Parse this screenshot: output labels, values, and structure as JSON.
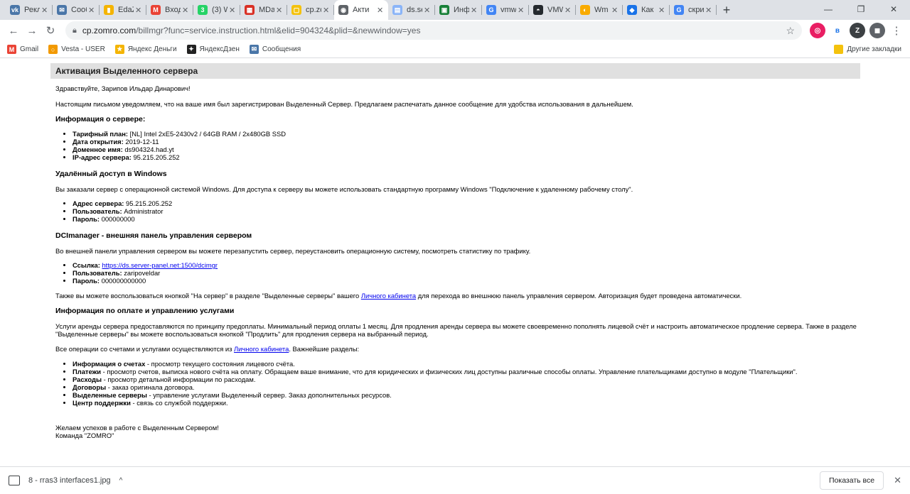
{
  "tabs": [
    {
      "title": "Рекл",
      "icon": "vk-icon",
      "color": "#4a76a8",
      "glyph": "vk"
    },
    {
      "title": "Сооб",
      "icon": "message-icon",
      "color": "#4a76a8",
      "glyph": "✉"
    },
    {
      "title": "EdaZ",
      "icon": "chart-icon",
      "color": "#f4b400",
      "glyph": "▮"
    },
    {
      "title": "Вход",
      "icon": "gmail-icon",
      "color": "#ea4335",
      "glyph": "M"
    },
    {
      "title": "(3) W",
      "icon": "whatsapp-icon",
      "color": "#25d366",
      "glyph": "3"
    },
    {
      "title": "MDa",
      "icon": "mdaemon-icon",
      "color": "#d93025",
      "glyph": "▦"
    },
    {
      "title": "cp.zo",
      "icon": "folder-icon",
      "color": "#f4c20d",
      "glyph": "▢"
    },
    {
      "title": "Акти",
      "icon": "globe-icon",
      "color": "#5f6368",
      "glyph": "◉",
      "active": true
    },
    {
      "title": "ds.se",
      "icon": "doc-icon",
      "color": "#8ab4f8",
      "glyph": "▤"
    },
    {
      "title": "Инф",
      "icon": "shield-icon",
      "color": "#188038",
      "glyph": "▣"
    },
    {
      "title": "vmw",
      "icon": "google-icon",
      "color": "#4285f4",
      "glyph": "G"
    },
    {
      "title": "VMW",
      "icon": "github-icon",
      "color": "#24292e",
      "glyph": "◓"
    },
    {
      "title": "Wm",
      "icon": "wm-icon",
      "color": "#f9ab00",
      "glyph": "◐"
    },
    {
      "title": "Как",
      "icon": "bookmark-icon",
      "color": "#1a73e8",
      "glyph": "◆"
    },
    {
      "title": "скри",
      "icon": "google-icon",
      "color": "#4285f4",
      "glyph": "G"
    }
  ],
  "url": {
    "host": "cp.zomro.com",
    "path": "/billmgr?func=service.instruction.html&elid=904324&plid=&newwindow=yes"
  },
  "extensions": [
    {
      "name": "ext-circle-icon",
      "color": "#e91e63",
      "glyph": "◎"
    },
    {
      "name": "ext-b-icon",
      "color": "#ffffff",
      "glyph": "в"
    },
    {
      "name": "ext-z-icon",
      "color": "#3c4043",
      "glyph": "Z"
    },
    {
      "name": "profile-avatar",
      "color": "#5f6368",
      "glyph": "◼"
    }
  ],
  "bookmarks": [
    {
      "label": "Gmail",
      "icon": "gmail-icon",
      "color": "#ea4335",
      "glyph": "M"
    },
    {
      "label": "Vesta - USER",
      "icon": "vesta-icon",
      "color": "#f29900",
      "glyph": "○"
    },
    {
      "label": "Яндекс Деньги",
      "icon": "yandex-money-icon",
      "color": "#f4b400",
      "glyph": "★"
    },
    {
      "label": "ЯндексДзен",
      "icon": "zen-icon",
      "color": "#222222",
      "glyph": "✦"
    },
    {
      "label": "Сообщения",
      "icon": "message-icon",
      "color": "#4a76a8",
      "glyph": "✉"
    }
  ],
  "other_bookmarks": "Другие закладки",
  "doc": {
    "header": "Активация Выделенного сервера",
    "greeting": "Здравствуйте, Зарипов Ильдар Динарович!",
    "intro": "Настоящим письмом уведомляем, что на ваше имя был зарегистрирован Выделенный Сервер. Предлагаем распечатать данное сообщение для удобства использования в дальнейшем.",
    "server_info_title": "Информация о сервере:",
    "server_info": [
      {
        "k": "Тарифный план:",
        "v": " [NL] Intel 2xE5-2430v2 / 64GB RAM / 2x480GB SSD"
      },
      {
        "k": "Дата открытия:",
        "v": " 2019-12-11"
      },
      {
        "k": "Доменное имя:",
        "v": " ds904324.had.yt"
      },
      {
        "k": "IP-адрес сервера:",
        "v": " 95.215.205.252"
      }
    ],
    "rdp_title": "Удалённый доступ в Windows",
    "rdp_text": "Вы заказали сервер с операционной системой Windows. Для доступа к серверу вы можете использовать стандартную программу Windows \"Подключение к удаленному рабочему столу\".",
    "rdp": [
      {
        "k": "Адрес сервера:",
        "v": " 95.215.205.252"
      },
      {
        "k": "Пользователь:",
        "v": " Administrator"
      },
      {
        "k": "Пароль:",
        "v": " 000000000"
      }
    ],
    "dci_title": "DCImanager - внешняя панель управления сервером",
    "dci_text": "Во внешней панели управления сервером вы можете перезапустить сервер, переустановить операционную систему, посмотреть статистику по трафику.",
    "dci_link_label": "Ссылка:",
    "dci_link": "https://ds.server-panel.net:1500/dcimgr",
    "dci_user_label": "Пользователь:",
    "dci_user": " zaripoveldar",
    "dci_pass_label": "Пароль:",
    "dci_pass": " 000000000000",
    "dci_extra_1": "Также вы можете воспользоваться кнопкой \"На сервер\" в разделе \"Выделенные серверы\" вашего ",
    "cabinet_link": "Личного кабинета",
    "dci_extra_2": " для перехода во внешнюю панель управления сервером. Авторизация будет проведена автоматически.",
    "billing_title": "Информация по оплате и управлению услугами",
    "billing_text": "Услуги аренды сервера предоставляются по принципу предоплаты. Минимальный период оплаты 1 месяц. Для продления аренды сервера вы можете своевременно пополнять лицевой счёт и настроить автоматическое продление сервера. Также в разделе \"Выделенные серверы\" вы можете воспользоваться кнопкой \"Продлить\" для продления сервера на выбранный период.",
    "ops_1": "Все операции со счетами и услугами осуществляются из ",
    "ops_2": ". Важнейшие разделы:",
    "sections": [
      {
        "k": "Информация о счетах",
        "v": " - просмотр текущего состояния лицевого счёта."
      },
      {
        "k": "Платежи",
        "v": " - просмотр счетов, выписка нового счёта на оплату. Обращаем ваше внимание, что для юридических и физических лиц доступны различные способы оплаты. Управление плательщиками доступно в модуле \"Плательщики\"."
      },
      {
        "k": "Расходы",
        "v": " - просмотр детальной информации по расходам."
      },
      {
        "k": "Договоры",
        "v": " - заказ оригинала договора."
      },
      {
        "k": "Выделенные серверы",
        "v": " - управление услугами Выделенный сервер. Заказ дополнительных ресурсов."
      },
      {
        "k": "Центр поддержки",
        "v": " - связь со службой поддержки."
      }
    ],
    "farewell": "Желаем успехов в работе с Выделенным Сервером!",
    "team": "Команда \"ZOMRO\""
  },
  "downloads": {
    "file": "8 - rras3 interfaces1.jpg",
    "show_all": "Показать все"
  }
}
